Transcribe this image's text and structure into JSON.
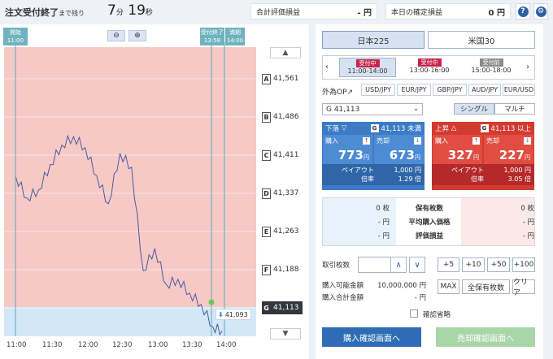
{
  "header": {
    "countdown_label": "注文受付終了",
    "countdown_suffix": "まで残り",
    "minutes": "7",
    "min_unit": "分",
    "seconds": "19",
    "sec_unit": "秒",
    "eval_label": "合計評価損益",
    "eval_value": "- 円",
    "fixed_label": "本日の確定損益",
    "fixed_value": "0 円",
    "help_icon": "question-icon",
    "settings_icon": "gear-icon"
  },
  "chart": {
    "flags": {
      "open_label": "開始",
      "open_time": "11:00",
      "close_label": "受付終了",
      "close_time": "13:58",
      "expire_label": "満期",
      "expire_time": "14:00"
    },
    "ladder": [
      {
        "letter": "A",
        "price": "41,561"
      },
      {
        "letter": "B",
        "price": "41,486"
      },
      {
        "letter": "C",
        "price": "41,411"
      },
      {
        "letter": "D",
        "price": "41,337"
      },
      {
        "letter": "E",
        "price": "41,263"
      },
      {
        "letter": "F",
        "price": "41,188"
      },
      {
        "letter": "G",
        "price": "41,113"
      }
    ],
    "current_price": "41,093",
    "x_ticks": [
      "11:00",
      "11:30",
      "12:00",
      "12:30",
      "13:00",
      "13:30",
      "14:00"
    ],
    "up_arrow": "▲",
    "down_arrow": "▼"
  },
  "chart_data": {
    "type": "line",
    "x_range": [
      "11:00",
      "14:00"
    ],
    "ylim": [
      41083,
      41600
    ],
    "x": [
      "11:00",
      "11:10",
      "11:20",
      "11:30",
      "11:40",
      "11:50",
      "12:00",
      "12:10",
      "12:20",
      "12:30",
      "12:40",
      "12:50",
      "13:00",
      "13:10",
      "13:20",
      "13:30",
      "13:40",
      "13:50",
      "13:58"
    ],
    "values": [
      41370,
      41330,
      41345,
      41390,
      41425,
      41440,
      41420,
      41370,
      41320,
      41410,
      41385,
      41200,
      41240,
      41175,
      41185,
      41160,
      41140,
      41100,
      41093
    ],
    "threshold": 41113
  },
  "markets": {
    "tab1": "日本225",
    "tab2": "米国30"
  },
  "sessions": [
    {
      "status": "受付中",
      "time": "11:00-14:00",
      "color": "#c8254d"
    },
    {
      "status": "受付中",
      "time": "13:00-16:00",
      "color": "#c8254d"
    },
    {
      "status": "受付前",
      "time": "15:00-18:00",
      "color": "#8a8a8a"
    }
  ],
  "fx": {
    "label": "外為OP",
    "pairs": [
      "USD/JPY",
      "EUR/JPY",
      "GBP/JPY",
      "AUD/JPY",
      "EUR/USD"
    ]
  },
  "select": {
    "value": "G 41,113"
  },
  "modes": {
    "single": "シングル",
    "multi": "マルチ"
  },
  "down_card": {
    "title": "下落",
    "target": "41,113 未満",
    "buy_label": "購入",
    "buy_price": "773",
    "sell_label": "売却",
    "sell_price": "673",
    "unit": "円",
    "payout_label": "ペイアウト",
    "payout": "1,000 円",
    "rate_label": "倍率",
    "rate": "1.29 倍"
  },
  "up_card": {
    "title": "上昇",
    "target": "41,113 以上",
    "buy_label": "購入",
    "buy_price": "327",
    "sell_label": "売却",
    "sell_price": "227",
    "unit": "円",
    "payout_label": "ペイアウト",
    "payout": "1,000 円",
    "rate_label": "倍率",
    "rate": "3.05 倍"
  },
  "positions": {
    "rows": [
      {
        "left": "0 枚",
        "label": "保有枚数",
        "right": "0 枚"
      },
      {
        "left": "- 円",
        "label": "平均購入価格",
        "right": "- 円"
      },
      {
        "left": "- 円",
        "label": "評価損益",
        "right": "- 円"
      }
    ]
  },
  "order": {
    "qty_label": "取引枚数",
    "qty_value": "",
    "inc": [
      "+5",
      "+10",
      "+50",
      "+100"
    ],
    "max": "MAX",
    "all_hold": "全保有枚数",
    "clear": "クリア",
    "available_label": "購入可能金額",
    "available_value": "10,000,000 円",
    "total_label": "購入合計金額",
    "total_value": "- 円",
    "skip_confirm": "確認省略",
    "buy_button": "購入確認画面へ",
    "sell_button": "売却確認画面へ"
  }
}
